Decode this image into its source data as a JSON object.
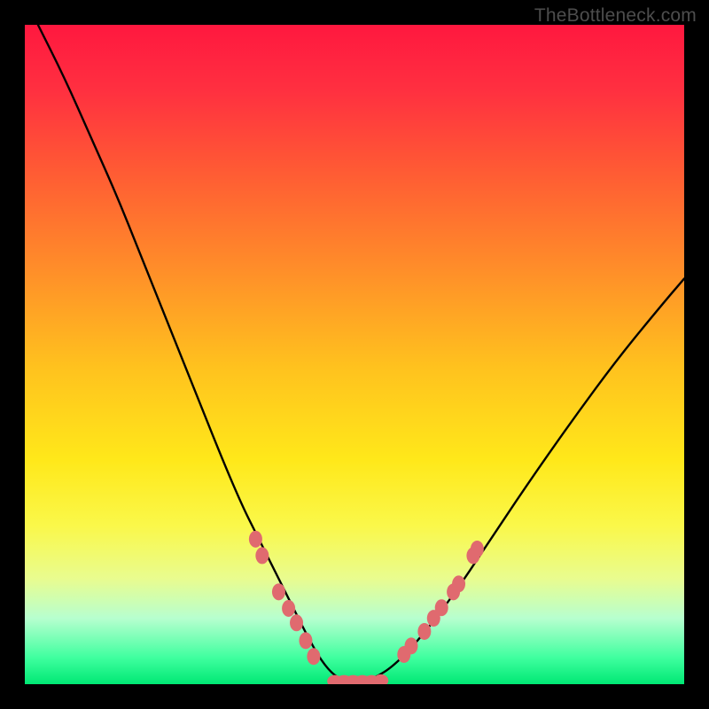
{
  "watermark": "TheBottleneck.com",
  "gradient": {
    "stops": [
      {
        "offset": "0%",
        "color": "#ff183f"
      },
      {
        "offset": "10%",
        "color": "#ff3040"
      },
      {
        "offset": "22%",
        "color": "#ff5a34"
      },
      {
        "offset": "36%",
        "color": "#ff8a2a"
      },
      {
        "offset": "52%",
        "color": "#ffc21e"
      },
      {
        "offset": "66%",
        "color": "#ffe81a"
      },
      {
        "offset": "76%",
        "color": "#faf84a"
      },
      {
        "offset": "84%",
        "color": "#e9fc8f"
      },
      {
        "offset": "90%",
        "color": "#b7ffcf"
      },
      {
        "offset": "96%",
        "color": "#3fff9f"
      },
      {
        "offset": "100%",
        "color": "#00e874"
      }
    ]
  },
  "marker_color": "#e06a6f",
  "chart_data": {
    "type": "line",
    "title": "",
    "xlabel": "",
    "ylabel": "",
    "x_range": [
      0,
      100
    ],
    "y_range": [
      0,
      100
    ],
    "series": [
      {
        "name": "curve",
        "x": [
          2,
          6,
          10,
          14,
          18,
          22,
          26,
          30,
          33,
          35,
          37,
          39,
          41,
          43,
          45,
          47,
          49,
          51,
          53,
          56,
          60,
          65,
          70,
          76,
          83,
          90,
          97,
          100
        ],
        "y": [
          100,
          92,
          83,
          74,
          64,
          54,
          44,
          34,
          27,
          23,
          19,
          15,
          11,
          7,
          3.5,
          1.2,
          0.4,
          0.4,
          0.9,
          2.8,
          7,
          13.5,
          21,
          30,
          40,
          49.5,
          58,
          61.5
        ]
      }
    ],
    "markers_left": [
      {
        "x": 35.0,
        "y": 22.0
      },
      {
        "x": 36.0,
        "y": 19.5
      },
      {
        "x": 38.5,
        "y": 14.0
      },
      {
        "x": 40.0,
        "y": 11.5
      },
      {
        "x": 41.2,
        "y": 9.3
      },
      {
        "x": 42.6,
        "y": 6.6
      },
      {
        "x": 43.8,
        "y": 4.2
      }
    ],
    "markers_right": [
      {
        "x": 57.5,
        "y": 4.5
      },
      {
        "x": 58.6,
        "y": 5.8
      },
      {
        "x": 60.6,
        "y": 8.0
      },
      {
        "x": 62.0,
        "y": 10.0
      },
      {
        "x": 63.2,
        "y": 11.6
      },
      {
        "x": 65.0,
        "y": 14.0
      },
      {
        "x": 65.8,
        "y": 15.2
      },
      {
        "x": 68.0,
        "y": 19.5
      },
      {
        "x": 68.6,
        "y": 20.5
      }
    ],
    "markers_bottom": [
      {
        "x": 47.0,
        "y": 0.45
      },
      {
        "x": 48.4,
        "y": 0.45
      },
      {
        "x": 49.8,
        "y": 0.45
      },
      {
        "x": 51.2,
        "y": 0.45
      },
      {
        "x": 52.6,
        "y": 0.45
      },
      {
        "x": 54.0,
        "y": 0.55
      }
    ]
  }
}
